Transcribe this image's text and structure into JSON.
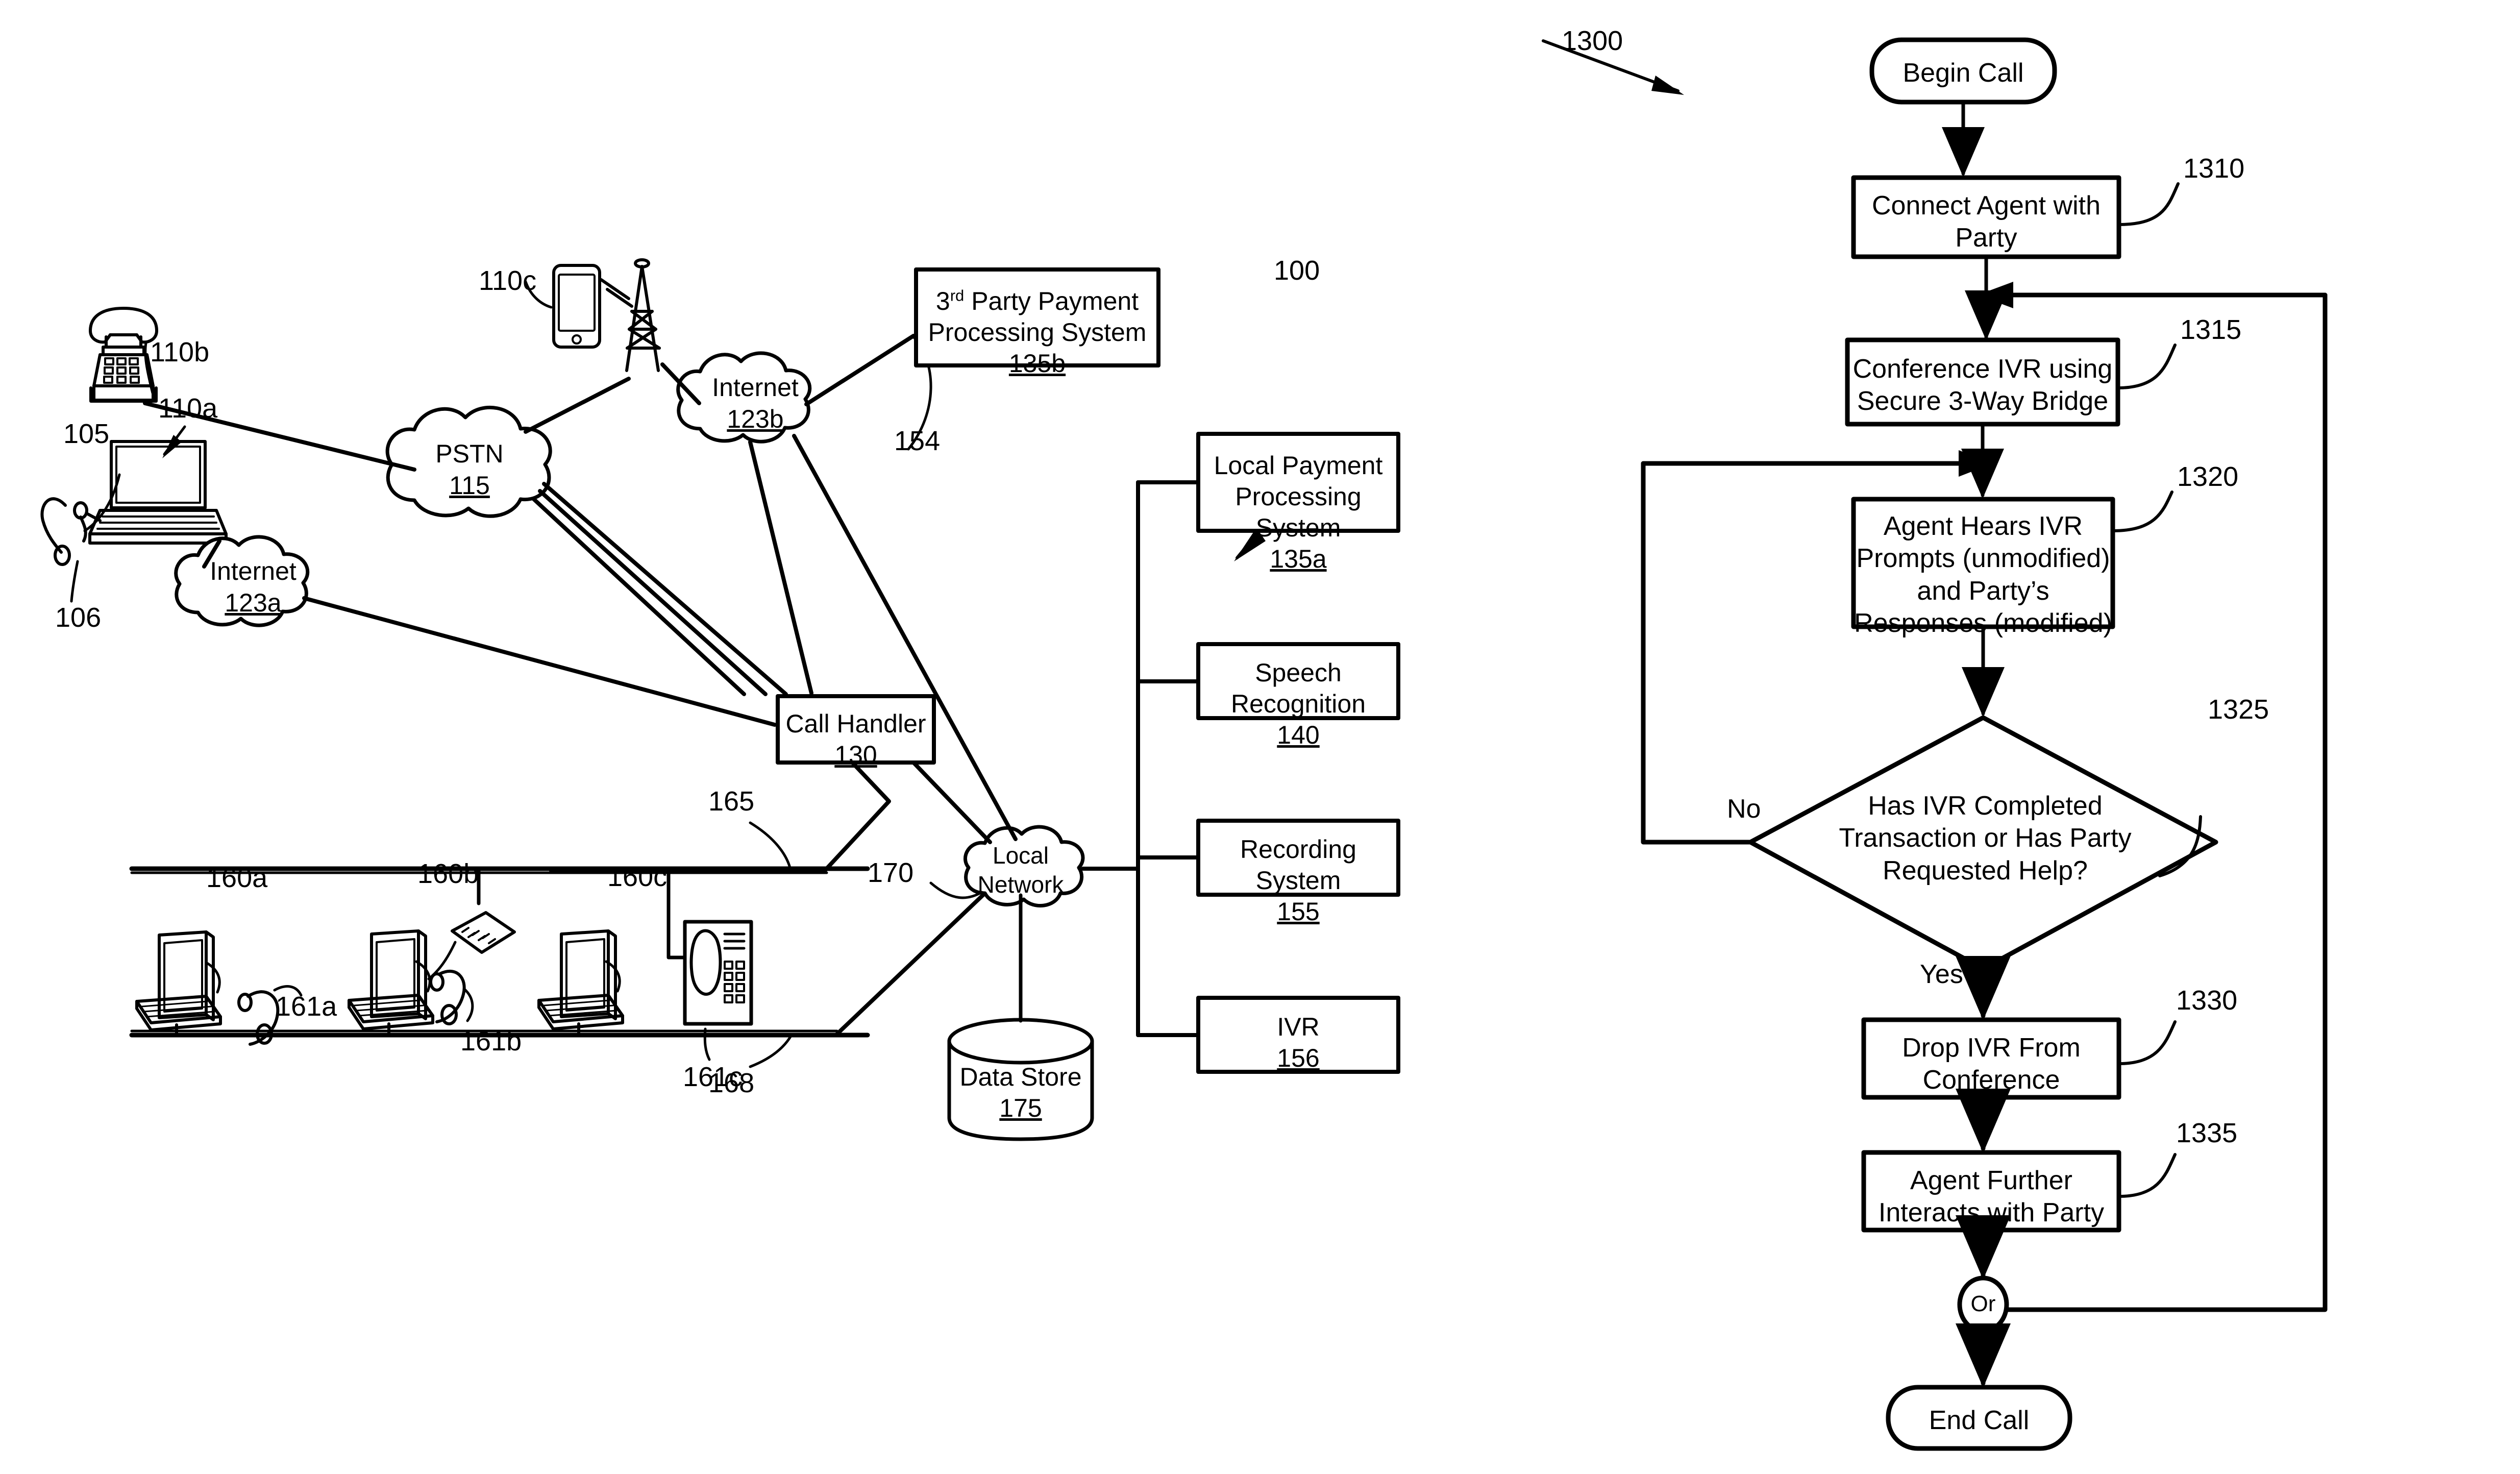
{
  "figure": {
    "left_diagram_ref": "100",
    "right_diagram_ref": "1300"
  },
  "system_diagram": {
    "reference_numerals": {
      "system": "100",
      "agent_workstation": "105",
      "headset": "106",
      "computer_party": "110a",
      "landline_phone": "110b",
      "mobile_phone": "110c",
      "pstn": "115",
      "internet_a": "123a",
      "internet_b": "123b",
      "call_handler": "130",
      "local_payment": "135a",
      "third_party_payment": "135b",
      "speech_recognition": "140",
      "trunk_154": "154",
      "recording_system": "155",
      "ivr": "156",
      "workstation_a": "160a",
      "workstation_b": "160b",
      "workstation_c": "160c",
      "headset_a": "161a",
      "headset_b": "161b",
      "agent_phone_c": "161c",
      "lan_link_165": "165",
      "lan_link_168": "168",
      "local_network_link_170": "170",
      "data_store": "175"
    },
    "clouds": [
      {
        "name": "pstn",
        "label": "PSTN",
        "num": "115"
      },
      {
        "name": "internet-a",
        "label": "Internet",
        "num": "123a"
      },
      {
        "name": "internet-b",
        "label": "Internet",
        "num": "123b"
      },
      {
        "name": "local-network",
        "line1": "Local",
        "line2": "Network"
      }
    ],
    "boxes": [
      {
        "name": "third-party-payment-processing-system",
        "line1_pre": "3",
        "line1_sup": "rd",
        "line1_post": " Party Payment",
        "line2": "Processing System",
        "num": "135b"
      },
      {
        "name": "local-payment-processing-system",
        "line1": "Local Payment",
        "line2": "Processing System",
        "num": "135a"
      },
      {
        "name": "speech-recognition",
        "line1": "Speech Recognition",
        "num": "140"
      },
      {
        "name": "recording-system",
        "line1": "Recording System",
        "num": "155"
      },
      {
        "name": "ivr",
        "line1": "IVR",
        "num": "156"
      },
      {
        "name": "call-handler",
        "line1": "Call Handler",
        "num": "130"
      }
    ],
    "data_store": {
      "label": "Data Store",
      "num": "175"
    }
  },
  "flowchart": {
    "ref": "1300",
    "terminators": {
      "begin": "Begin Call",
      "end": "End Call"
    },
    "junction_label": "Or",
    "branch_labels": {
      "no": "No",
      "yes": "Yes"
    },
    "steps": [
      {
        "name": "connect-agent-with-party",
        "line1": "Connect Agent with",
        "line2": "Party",
        "ref": "1310"
      },
      {
        "name": "conference-ivr-secure-bridge",
        "line1": "Conference IVR using",
        "line2": "Secure 3-Way Bridge",
        "ref": "1315"
      },
      {
        "name": "agent-hears-ivr-prompts",
        "line1": "Agent Hears IVR",
        "line2": "Prompts (unmodified)",
        "line3": "and Party’s",
        "line4": "Responses (modified)",
        "ref": "1320"
      },
      {
        "name": "decision-ivr-completed",
        "line1": "Has IVR Completed",
        "line2": "Transaction or Has Party",
        "line3": "Requested Help?",
        "ref": "1325"
      },
      {
        "name": "drop-ivr-from-conference",
        "line1": "Drop IVR From",
        "line2": "Conference",
        "ref": "1330"
      },
      {
        "name": "agent-further-interacts",
        "line1": "Agent Further",
        "line2": "Interacts with Party",
        "ref": "1335"
      }
    ]
  },
  "colors": {
    "ink": "#000000",
    "paper": "#ffffff"
  }
}
